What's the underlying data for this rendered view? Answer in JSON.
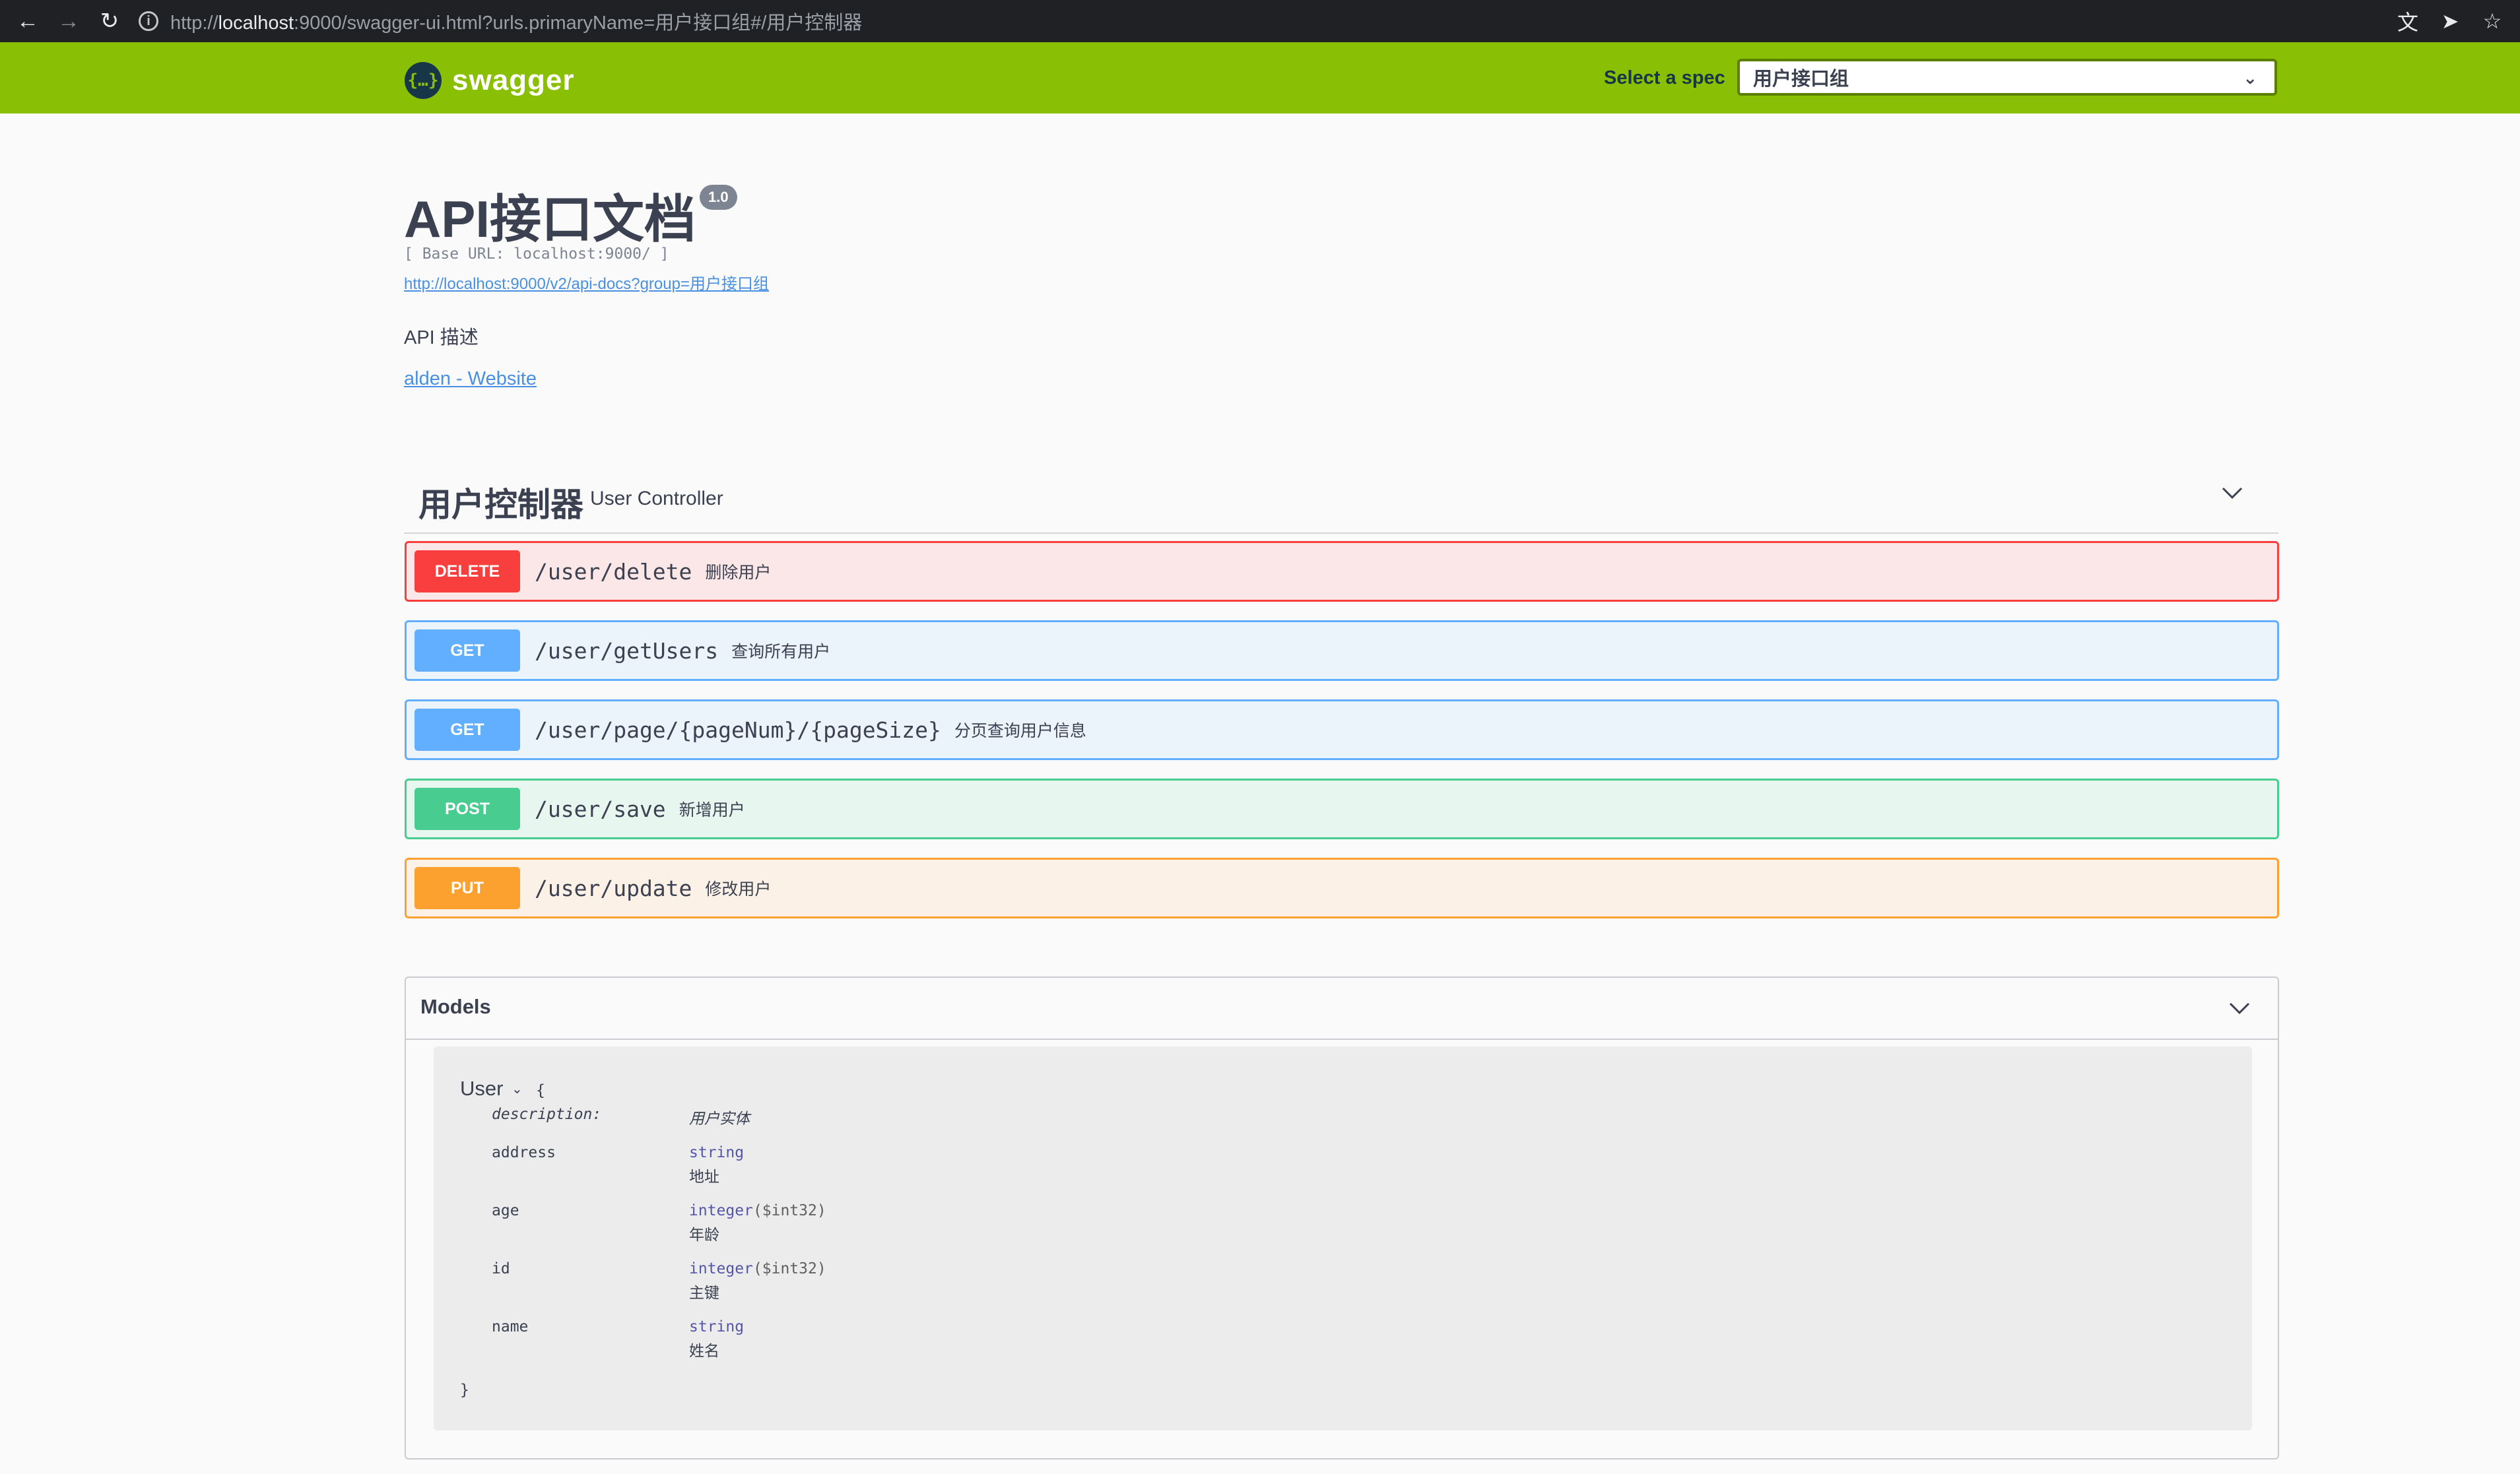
{
  "browser": {
    "url_scheme": "http://",
    "url_host": "localhost",
    "url_rest": ":9000/swagger-ui.html?urls.primaryName=用户接口组#/用户控制器"
  },
  "topbar": {
    "logo_mark": "{…}",
    "logo_text": "swagger",
    "spec_label": "Select a spec",
    "spec_selected": "用户接口组"
  },
  "info": {
    "title": "API接口文档",
    "version": "1.0",
    "base_url": "[ Base URL: localhost:9000/ ]",
    "docs_link": "http://localhost:9000/v2/api-docs?group=用户接口组",
    "description": "API 描述",
    "contact": "alden - Website"
  },
  "tag": {
    "name": "用户控制器",
    "description": "User Controller"
  },
  "operations": [
    {
      "method": "DELETE",
      "path": "/user/delete",
      "summary": "删除用户"
    },
    {
      "method": "GET",
      "path": "/user/getUsers",
      "summary": "查询所有用户"
    },
    {
      "method": "GET",
      "path": "/user/page/{pageNum}/{pageSize}",
      "summary": "分页查询用户信息"
    },
    {
      "method": "POST",
      "path": "/user/save",
      "summary": "新增用户"
    },
    {
      "method": "PUT",
      "path": "/user/update",
      "summary": "修改用户"
    }
  ],
  "models": {
    "title": "Models",
    "model": {
      "name": "User",
      "open_brace": "{",
      "close_brace": "}",
      "description_key": "description:",
      "description_value": "用户实体",
      "properties": [
        {
          "name": "address",
          "type": "string",
          "format": "",
          "description": "地址"
        },
        {
          "name": "age",
          "type": "integer",
          "format": "($int32)",
          "description": "年龄"
        },
        {
          "name": "id",
          "type": "integer",
          "format": "($int32)",
          "description": "主键"
        },
        {
          "name": "name",
          "type": "string",
          "format": "",
          "description": "姓名"
        }
      ]
    }
  },
  "icons": {
    "back": "arrow-left-icon",
    "forward": "arrow-right-icon",
    "reload": "reload-icon",
    "info": "info-icon",
    "translate": "translate-icon",
    "send": "send-icon",
    "bookmark": "star-icon"
  }
}
